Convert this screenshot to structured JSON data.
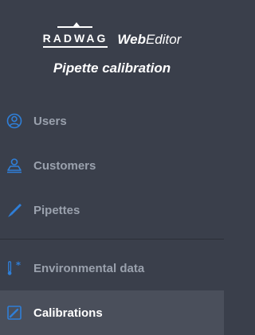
{
  "app": {
    "brand": "RADWAG",
    "product_bold": "Web",
    "product_regular": "Editor",
    "subtitle": "Pipette calibration"
  },
  "nav": [
    {
      "label": "Users",
      "icon": "users-icon"
    },
    {
      "label": "Customers",
      "icon": "customers-icon"
    },
    {
      "label": "Pipettes",
      "icon": "pipette-icon"
    },
    {
      "label": "Environmental data",
      "icon": "thermometer-icon"
    },
    {
      "label": "Calibrations",
      "icon": "calibration-icon",
      "active": true
    }
  ],
  "colors": {
    "background": "#3a3f4b",
    "active_background": "#4a4f5b",
    "icon_blue": "#2f7fd8",
    "label_muted": "#9aa1ad",
    "label_active": "#ffffff"
  }
}
